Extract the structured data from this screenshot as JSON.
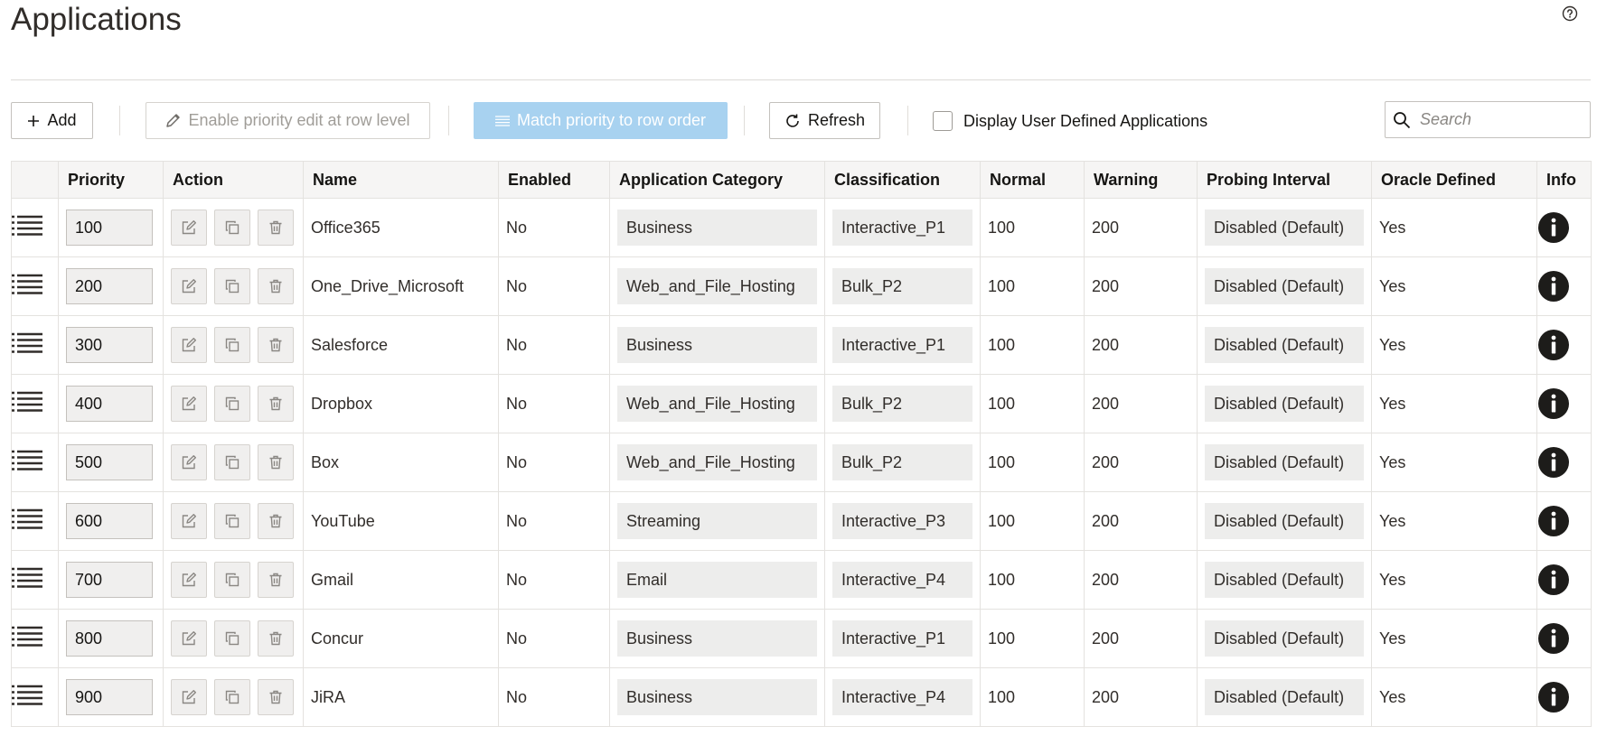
{
  "page": {
    "title": "Applications"
  },
  "toolbar": {
    "add_label": "Add",
    "enable_priority_label": "Enable priority edit at row level",
    "match_priority_label": "Match priority to row order",
    "refresh_label": "Refresh",
    "display_user_defined_label": "Display User Defined Applications",
    "search_placeholder": "Search"
  },
  "table": {
    "headers": {
      "priority": "Priority",
      "action": "Action",
      "name": "Name",
      "enabled": "Enabled",
      "category": "Application Category",
      "classification": "Classification",
      "normal": "Normal",
      "warning": "Warning",
      "probing": "Probing Interval",
      "oracle": "Oracle Defined",
      "info": "Info"
    },
    "rows": [
      {
        "priority": "100",
        "name": "Office365",
        "enabled": "No",
        "category": "Business",
        "classification": "Interactive_P1",
        "normal": "100",
        "warning": "200",
        "probing": "Disabled (Default)",
        "oracle": "Yes"
      },
      {
        "priority": "200",
        "name": "One_Drive_Microsoft",
        "enabled": "No",
        "category": "Web_and_File_Hosting",
        "classification": "Bulk_P2",
        "normal": "100",
        "warning": "200",
        "probing": "Disabled (Default)",
        "oracle": "Yes"
      },
      {
        "priority": "300",
        "name": "Salesforce",
        "enabled": "No",
        "category": "Business",
        "classification": "Interactive_P1",
        "normal": "100",
        "warning": "200",
        "probing": "Disabled (Default)",
        "oracle": "Yes"
      },
      {
        "priority": "400",
        "name": "Dropbox",
        "enabled": "No",
        "category": "Web_and_File_Hosting",
        "classification": "Bulk_P2",
        "normal": "100",
        "warning": "200",
        "probing": "Disabled (Default)",
        "oracle": "Yes"
      },
      {
        "priority": "500",
        "name": "Box",
        "enabled": "No",
        "category": "Web_and_File_Hosting",
        "classification": "Bulk_P2",
        "normal": "100",
        "warning": "200",
        "probing": "Disabled (Default)",
        "oracle": "Yes"
      },
      {
        "priority": "600",
        "name": "YouTube",
        "enabled": "No",
        "category": "Streaming",
        "classification": "Interactive_P3",
        "normal": "100",
        "warning": "200",
        "probing": "Disabled (Default)",
        "oracle": "Yes"
      },
      {
        "priority": "700",
        "name": "Gmail",
        "enabled": "No",
        "category": "Email",
        "classification": "Interactive_P4",
        "normal": "100",
        "warning": "200",
        "probing": "Disabled (Default)",
        "oracle": "Yes"
      },
      {
        "priority": "800",
        "name": "Concur",
        "enabled": "No",
        "category": "Business",
        "classification": "Interactive_P1",
        "normal": "100",
        "warning": "200",
        "probing": "Disabled (Default)",
        "oracle": "Yes"
      },
      {
        "priority": "900",
        "name": "JiRA",
        "enabled": "No",
        "category": "Business",
        "classification": "Interactive_P4",
        "normal": "100",
        "warning": "200",
        "probing": "Disabled (Default)",
        "oracle": "Yes"
      }
    ]
  }
}
